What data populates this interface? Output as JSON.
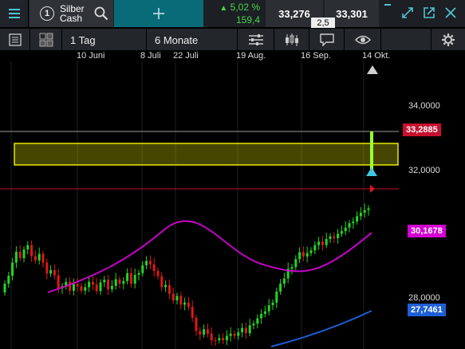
{
  "header": {
    "instrument_number": "1",
    "instrument_name_line1": "Silber",
    "instrument_name_line2": "Cash",
    "change_percent": "5,02 %",
    "change_abs": "159,4",
    "bid": "33,276",
    "ask": "33,301",
    "spread": "2,5",
    "up_color": "#47d64b",
    "tab_color": "#0a6b78"
  },
  "toolbar": {
    "interval": "1 Tag",
    "range": "6 Monate"
  },
  "x_axis": {
    "labels": [
      "10 Juni",
      "8 Juli",
      "22 Juli",
      "19 Aug.",
      "16 Sep.",
      "14 Okt."
    ]
  },
  "price_axis": {
    "labels": [
      "34,0000",
      "32,0000",
      "28,0000"
    ]
  },
  "price_tags": {
    "current": "33,2885",
    "ma_short": "30,1678",
    "ma_long": "27,7461",
    "current_color": "#c8102e",
    "ma_short_color": "#d400d4",
    "ma_long_color": "#1e5fd6"
  },
  "icons": [
    "hamburger-icon",
    "search-icon",
    "plus-icon",
    "up-triangle-icon",
    "minimize-icon",
    "expand-icon",
    "popout-icon",
    "close-icon",
    "list-icon",
    "layout-grid-icon",
    "indicators-icon",
    "candlestick-icon",
    "comment-icon",
    "eye-icon",
    "settings-icon",
    "home-marker-icon",
    "alert-marker-icon"
  ]
}
